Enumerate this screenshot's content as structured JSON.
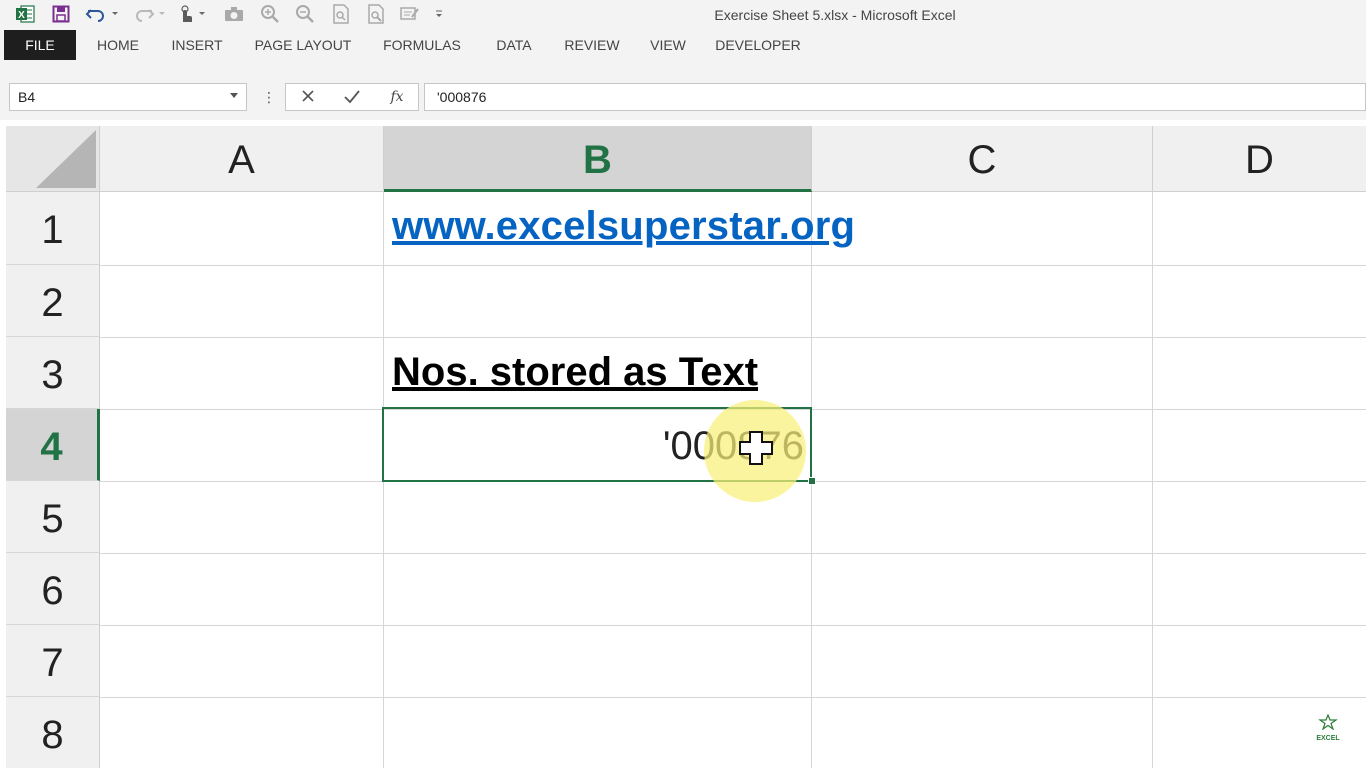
{
  "window": {
    "title": "Exercise Sheet 5.xlsx - Microsoft Excel"
  },
  "qat": {
    "icons": [
      "excel-logo-icon",
      "save-icon",
      "undo-icon",
      "redo-icon",
      "touch-mode-icon",
      "camera-icon",
      "zoom-in-icon",
      "zoom-out-icon",
      "print-preview-icon",
      "print-icon",
      "spelling-icon",
      "customize-qat-icon"
    ]
  },
  "ribbon": {
    "tabs": [
      "FILE",
      "HOME",
      "INSERT",
      "PAGE LAYOUT",
      "FORMULAS",
      "DATA",
      "REVIEW",
      "VIEW",
      "DEVELOPER"
    ]
  },
  "formula_bar": {
    "name_box": "B4",
    "fx_label": "fx",
    "formula": "'000876"
  },
  "grid": {
    "columns": [
      "A",
      "B",
      "C",
      "D"
    ],
    "selected_column": "B",
    "rows": [
      "1",
      "2",
      "3",
      "4",
      "5",
      "6",
      "7",
      "8"
    ],
    "selected_row": "4",
    "cells": {
      "B1": "www.excelsuperstar.org",
      "B3": "Nos. stored as Text",
      "B4": "'000876"
    }
  },
  "watermark": {
    "text": "EXCEL"
  },
  "colors": {
    "excel_green": "#217346",
    "hyperlink": "#0563c1",
    "file_tab": "#1e1e1e",
    "highlight": "#faf078"
  }
}
